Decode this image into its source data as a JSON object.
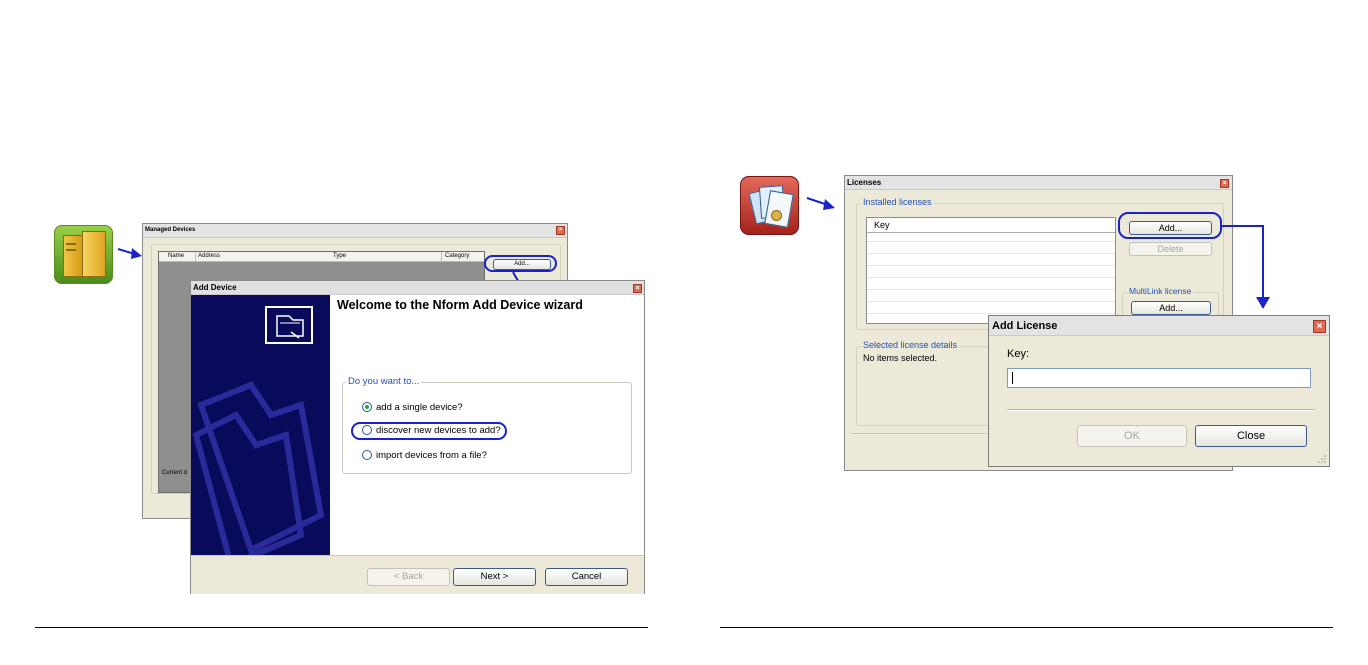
{
  "left_panel": {
    "icon": "managed-devices-app-icon",
    "managed_devices": {
      "title": "Managed Devices",
      "columns": [
        "Name",
        "Address",
        "Type",
        "Category"
      ],
      "add_button": "Add...",
      "status_text": "Current d"
    },
    "add_device": {
      "title": "Add Device",
      "heading": "Welcome to the Nform Add Device wizard",
      "group_label": "Do you want to...",
      "options": [
        {
          "label": "add a single device?",
          "selected": true
        },
        {
          "label": "discover new devices to add?",
          "selected": false
        },
        {
          "label": "import devices from a file?",
          "selected": false
        }
      ],
      "back_button": "< Back",
      "next_button": "Next >",
      "cancel_button": "Cancel"
    }
  },
  "right_panel": {
    "icon": "licenses-app-icon",
    "licenses": {
      "title": "Licenses",
      "installed_label": "Installed licenses",
      "key_column": "Key",
      "add_button": "Add...",
      "delete_button": "Delete",
      "multilink_label": "MultiLink license",
      "multilink_add_button": "Add...",
      "selected_details_label": "Selected license details",
      "no_items_text": "No items selected."
    },
    "add_license": {
      "title": "Add License",
      "key_label": "Key:",
      "key_value": "",
      "ok_button": "OK",
      "close_button": "Close"
    }
  },
  "colors": {
    "callout_blue": "#1a22c8",
    "wizard_sidebar": "#0a0a5a",
    "group_label_blue": "#2350b6"
  }
}
